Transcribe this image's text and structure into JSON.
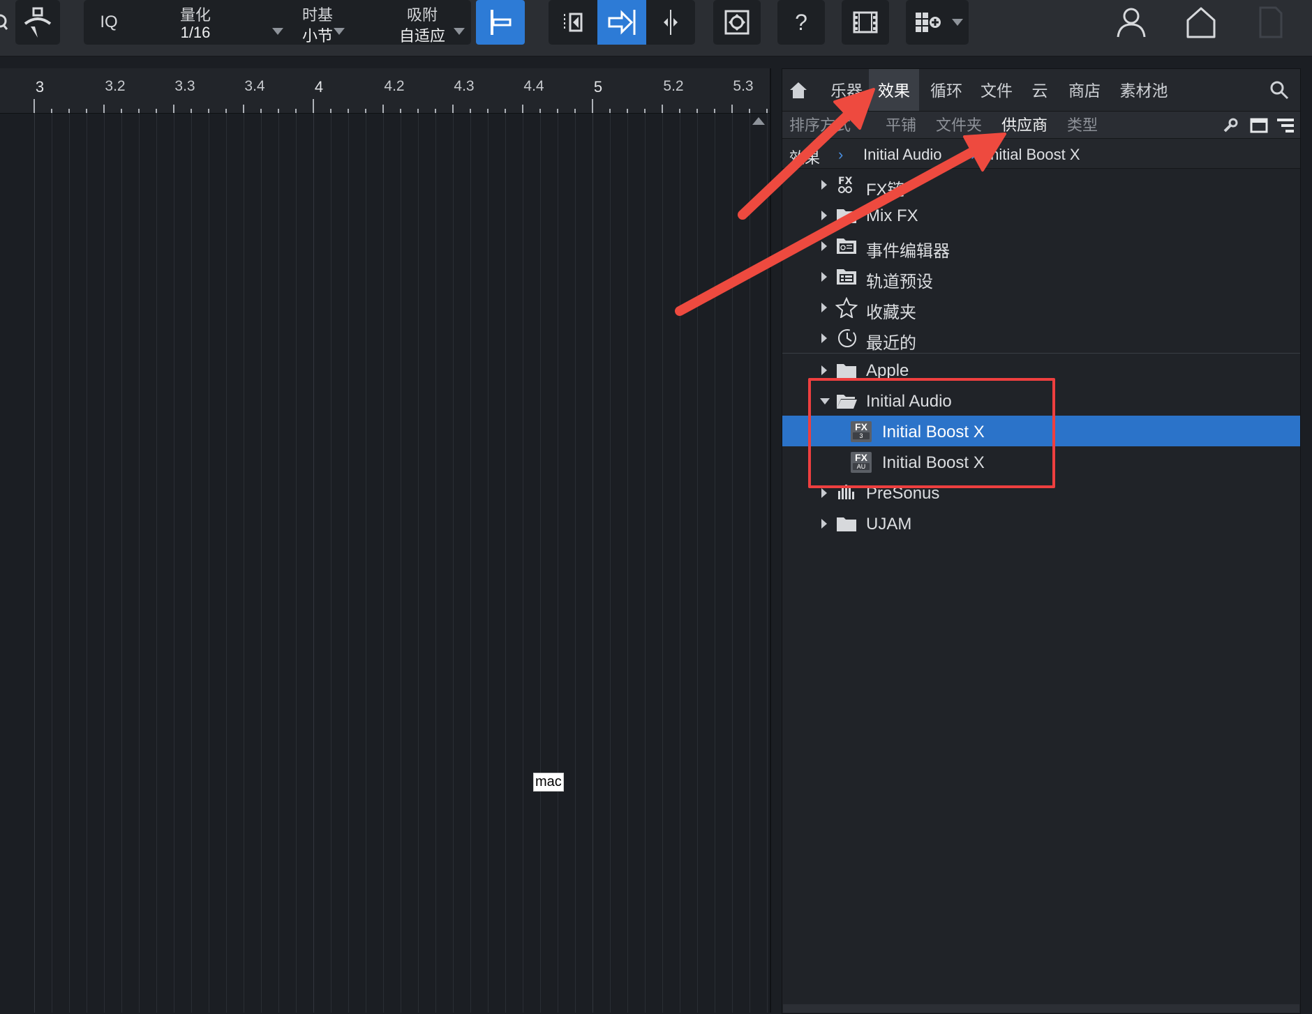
{
  "toolbar": {
    "iq_label": "IQ",
    "quantize": {
      "label": "量化",
      "value": "1/16"
    },
    "timebase": {
      "label": "时基",
      "value": "小节"
    },
    "snap": {
      "label": "吸附",
      "value": "自适应"
    },
    "help_label": "?"
  },
  "ruler": {
    "labels": [
      "3",
      "3.2",
      "3.3",
      "3.4",
      "4",
      "4.2",
      "4.3",
      "4.4",
      "5",
      "5.2",
      "5.3"
    ]
  },
  "arrange": {
    "watermark": "mac"
  },
  "browser": {
    "tabs": [
      "乐器",
      "效果",
      "循环",
      "文件",
      "云",
      "商店",
      "素材池"
    ],
    "active_tab": "效果",
    "subtabs": [
      "排序方式",
      "平铺",
      "文件夹",
      "供应商",
      "类型"
    ],
    "active_subtab": "供应商",
    "breadcrumb": {
      "root": "效果",
      "vendor": "Initial Audio",
      "plugin": "Initial Boost X"
    },
    "tree": [
      {
        "label": "FX链",
        "icon": "fx-chain-icon"
      },
      {
        "label": "Mix FX",
        "icon": "folder-icon"
      },
      {
        "label": "事件编辑器",
        "icon": "event-editor-icon"
      },
      {
        "label": "轨道预设",
        "icon": "track-preset-icon"
      },
      {
        "label": "收藏夹",
        "icon": "star-icon"
      },
      {
        "label": "最近的",
        "icon": "clock-icon"
      },
      {
        "label": "Apple",
        "icon": "folder-icon"
      },
      {
        "label": "Initial Audio",
        "icon": "folder-open-icon",
        "expanded": true
      },
      {
        "label": "Initial Boost X",
        "icon": "fx-vst3-icon",
        "badge": "FX",
        "sub": "3",
        "selected": true
      },
      {
        "label": "Initial Boost X",
        "icon": "fx-au-icon",
        "badge": "FX",
        "sub": "AU"
      },
      {
        "label": "PreSonus",
        "icon": "presonus-icon"
      },
      {
        "label": "UJAM",
        "icon": "folder-icon"
      }
    ]
  },
  "colors": {
    "accent": "#2d7bd6",
    "selection": "#2b73c9",
    "annotation": "#ee3f3f",
    "background": "#1b1e23"
  }
}
